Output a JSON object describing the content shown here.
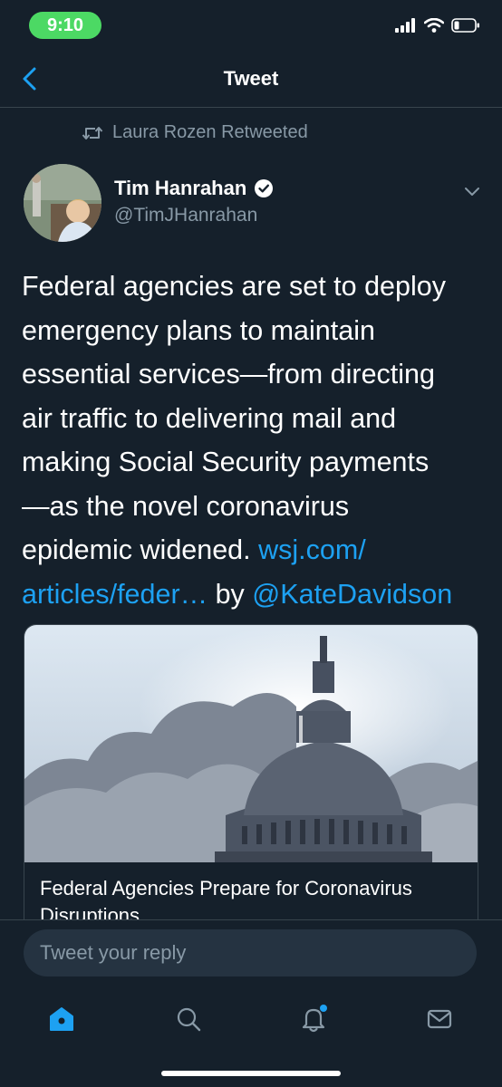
{
  "status_bar": {
    "time": "9:10"
  },
  "nav": {
    "title": "Tweet"
  },
  "retweet": {
    "text": "Laura Rozen Retweeted"
  },
  "author": {
    "name": "Tim Hanrahan",
    "handle": "@TimJHanrahan"
  },
  "tweet": {
    "text_lines": [
      "Federal agencies are set to deploy",
      "emergency plans to maintain",
      "essential services—from directing",
      "air traffic to delivering mail and",
      "making Social Security payments",
      "—as the novel coronavirus",
      "epidemic widened."
    ],
    "link_part1": "wsj.com/",
    "link_part2": "articles/feder…",
    "by_text": "by",
    "mention": "@KateDavidson"
  },
  "card": {
    "title": "Federal Agencies Prepare for Coronavirus Disruptions"
  },
  "reply": {
    "placeholder": "Tweet your reply"
  },
  "tabs": [
    "home-icon",
    "search-icon",
    "notifications-icon",
    "messages-icon"
  ],
  "colors": {
    "background": "#15202b",
    "accent": "#1da1f2",
    "secondary_text": "#8899a6",
    "time_pill": "#4cd964"
  }
}
